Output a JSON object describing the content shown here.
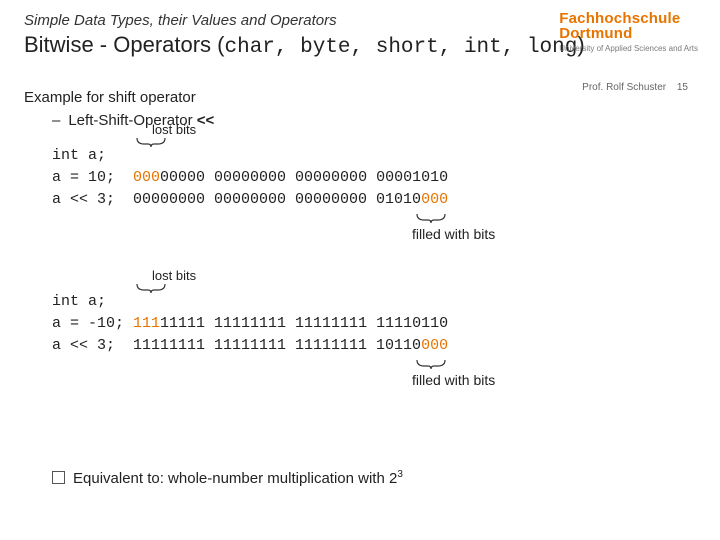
{
  "header": {
    "supertitle": "Simple Data Types, their Values and Operators",
    "title_lead": "Bitwise - Operators (",
    "title_types": "char, byte, short, int, long",
    "title_tail": ")"
  },
  "brand": {
    "line1": "Fachhochschule",
    "line2": "Dortmund",
    "sub": "University of Applied Sciences and Arts"
  },
  "meta": {
    "author": "Prof. Rolf Schuster",
    "page": "15"
  },
  "body": {
    "example_heading": "Example for shift operator",
    "bullet_text": "Left-Shift-Operator ",
    "bullet_op": "<<",
    "lost_label": "lost bits",
    "filled_label": "filled with bits",
    "block1": {
      "decl": "int a;",
      "assign_lhs": "a = 10;  ",
      "assign_hi": "000",
      "assign_rest": "00000 00000000 00000000 00001010",
      "shift_lhs": "a << 3;  ",
      "shift_main": "00000000 00000000 00000000 01010",
      "shift_hi": "000"
    },
    "block2": {
      "decl": "int a;",
      "assign_lhs": "a = -10; ",
      "assign_hi": "111",
      "assign_rest": "11111 11111111 11111111 11110110",
      "shift_lhs": "a << 3;  ",
      "shift_main": "11111111 11111111 11111111 10110",
      "shift_hi": "000"
    },
    "equiv_lead": "Equivalent to: whole-number multiplication with 2",
    "equiv_exp": "3"
  }
}
